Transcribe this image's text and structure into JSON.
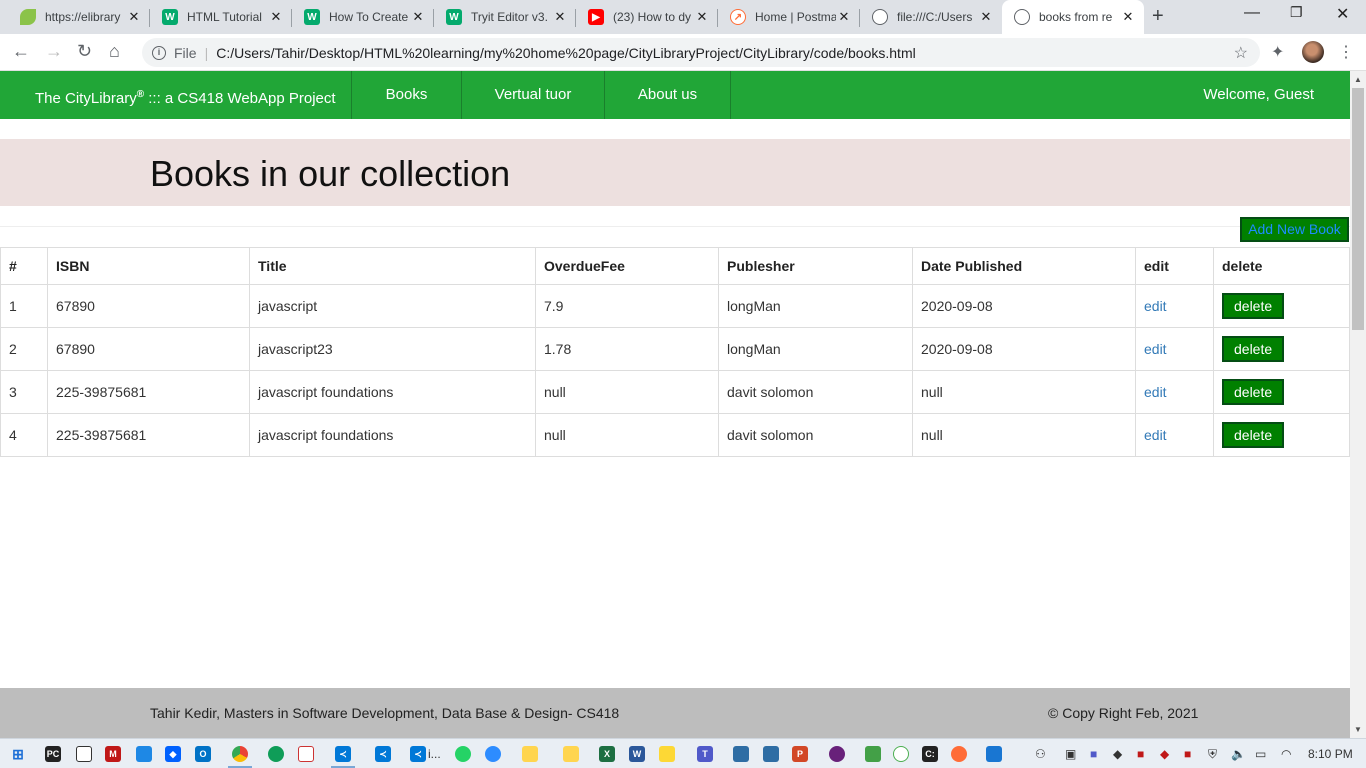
{
  "browser": {
    "tabs": [
      {
        "title": "https://elibrary",
        "fav": "leaf-icon",
        "color": "#8bc34a"
      },
      {
        "title": "HTML Tutorial",
        "fav": "w3schools-icon",
        "color": "#04aa6d"
      },
      {
        "title": "How To Create",
        "fav": "w3schools-icon",
        "color": "#04aa6d"
      },
      {
        "title": "Tryit Editor v3.",
        "fav": "w3schools-icon",
        "color": "#04aa6d"
      },
      {
        "title": "(23) How to dy",
        "fav": "youtube-icon",
        "color": "#ff0000"
      },
      {
        "title": "Home | Postma",
        "fav": "postman-icon",
        "color": "#ff6c37"
      },
      {
        "title": "file:///C:/Users",
        "fav": "globe-icon",
        "color": "#5f6368"
      },
      {
        "title": "books from re",
        "fav": "globe-icon",
        "color": "#5f6368"
      }
    ],
    "address": {
      "scheme_label": "File",
      "url": "C:/Users/Tahir/Desktop/HTML%20learning/my%20home%20page/CityLibraryProject/CityLibrary/code/books.html"
    }
  },
  "site": {
    "brand": "The CityLibrary",
    "brand_sup": "®",
    "brand_suffix": " ::: a CS418 WebApp Project",
    "nav": [
      "Books",
      "Vertual tuor",
      "About us"
    ],
    "welcome": "Welcome, Guest",
    "heading": "Books in our collection",
    "add_button": "Add New Book",
    "table": {
      "headers": [
        "#",
        "ISBN",
        "Title",
        "OverdueFee",
        "Publesher",
        "Date Published",
        "edit",
        "delete"
      ],
      "rows": [
        {
          "n": "1",
          "isbn": "67890",
          "title": "javascript",
          "fee": "7.9",
          "publisher": "longMan",
          "date": "2020-09-08",
          "edit": "edit",
          "delete": "delete"
        },
        {
          "n": "2",
          "isbn": "67890",
          "title": "javascript23",
          "fee": "1.78",
          "publisher": "longMan",
          "date": "2020-09-08",
          "edit": "edit",
          "delete": "delete"
        },
        {
          "n": "3",
          "isbn": "225-39875681",
          "title": "javascript foundations",
          "fee": "null",
          "publisher": "davit solomon",
          "date": "null",
          "edit": "edit",
          "delete": "delete"
        },
        {
          "n": "4",
          "isbn": "225-39875681",
          "title": "javascript foundations",
          "fee": "null",
          "publisher": "davit solomon",
          "date": "null",
          "edit": "edit",
          "delete": "delete"
        }
      ]
    },
    "footer_left": "Tahir Kedir, Masters in Software Development, Data Base & Design- CS418",
    "footer_right": "© Copy Right Feb, 2021"
  },
  "taskbar": {
    "clock": "8:10 PM",
    "vscode_label": "i..."
  },
  "colors": {
    "nav_green": "#21a637",
    "button_green": "#008000",
    "jumbotron": "#ede0df",
    "footer": "#bdbdbd",
    "link_blue": "#337ab7"
  }
}
